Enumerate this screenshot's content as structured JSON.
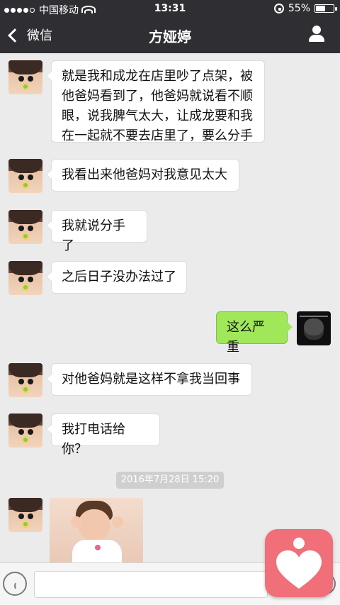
{
  "status_bar": {
    "carrier": "中国移动",
    "time": "13:31",
    "battery_percent": "55%",
    "battery_level": 0.55
  },
  "nav": {
    "back_label": "微信",
    "title": "方娅婷"
  },
  "messages": [
    {
      "side": "left",
      "text_lines": [
        "就是我和成龙在店里吵了点架，被",
        "他爸妈看到了，他爸妈就说看不顺",
        "眼，说我脾气太大，让成龙要和我",
        "在一起就不要去店里了，要么分手"
      ]
    },
    {
      "side": "left",
      "text": "我看出来他爸妈对我意见太大"
    },
    {
      "side": "left",
      "text": "我就说分手了"
    },
    {
      "side": "left",
      "text": "之后日子没办法过了"
    },
    {
      "side": "right",
      "text": "这么严重"
    },
    {
      "side": "left",
      "text": "对他爸妈就是这样不拿我当回事"
    },
    {
      "side": "left",
      "text": "我打电话给你？"
    }
  ],
  "timestamp": "2016年7月28日 15:20",
  "colors": {
    "header_bg": "#2f2f33",
    "chat_bg": "#ebebeb",
    "bubble_in": "#ffffff",
    "bubble_out": "#a0e759",
    "timestamp_bg": "#cfcfcf",
    "badge": "#f06f79"
  },
  "icons": {
    "back": "chevron-left-icon",
    "profile": "user-icon",
    "voice": "voice-icon",
    "more": "plus-icon",
    "overlay": "heart-app-icon"
  }
}
